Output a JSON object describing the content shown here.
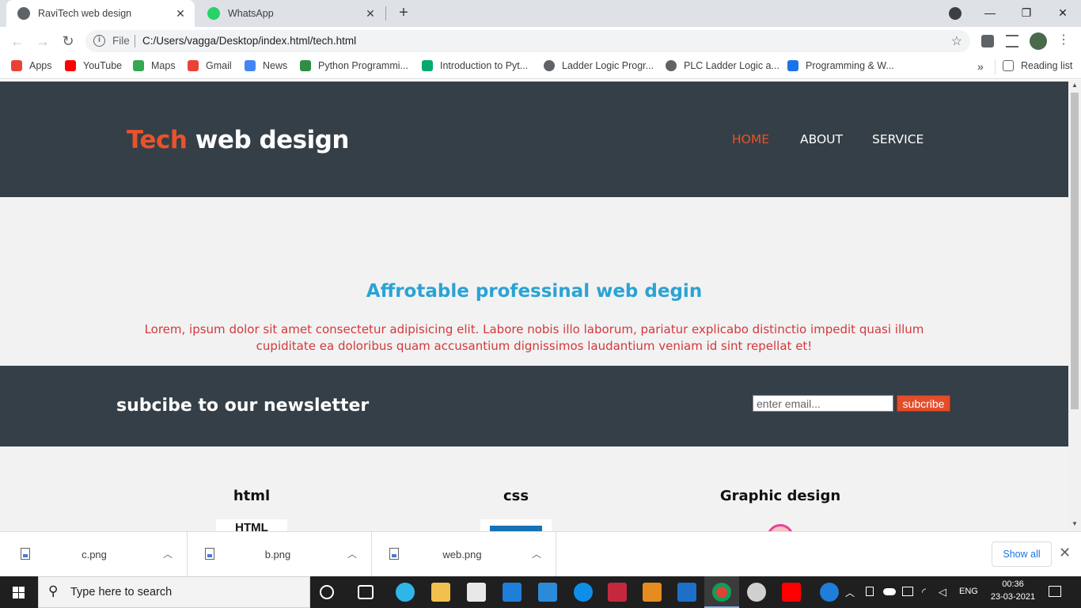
{
  "browser": {
    "tabs": [
      {
        "title": "RaviTech web design",
        "close": "✕"
      },
      {
        "title": "WhatsApp",
        "close": "✕"
      }
    ],
    "new_tab": "+",
    "window_controls": {
      "minimize": "—",
      "restore": "❐",
      "close": "✕"
    },
    "address": {
      "scheme": "File",
      "url": "C:/Users/vagga/Desktop/index.html/tech.html"
    },
    "bookmarks": [
      {
        "label": "Apps",
        "icon": "apps-grid-icon",
        "color": "#e94235"
      },
      {
        "label": "YouTube",
        "icon": "youtube-icon",
        "color": "#ff0000"
      },
      {
        "label": "Maps",
        "icon": "maps-icon",
        "color": "#34a853"
      },
      {
        "label": "Gmail",
        "icon": "gmail-icon",
        "color": "#ea4335"
      },
      {
        "label": "News",
        "icon": "news-icon",
        "color": "#4285f4"
      },
      {
        "label": "Python Programmi...",
        "icon": "gfg-icon",
        "color": "#2f8d46"
      },
      {
        "label": "Introduction to Pyt...",
        "icon": "w3-icon",
        "color": "#04aa6d"
      },
      {
        "label": "Ladder Logic Progr...",
        "icon": "globe-icon",
        "color": "#5f6368"
      },
      {
        "label": "PLC Ladder Logic a...",
        "icon": "globe-icon",
        "color": "#5f6368"
      },
      {
        "label": "Programming & W...",
        "icon": "udemy-icon",
        "color": "#1a73e8"
      }
    ],
    "more": "»",
    "reading_list": "Reading list"
  },
  "site": {
    "logo_accent": "Tech",
    "logo_rest": " web design",
    "nav": [
      "HOME",
      "ABOUT",
      "SERVICE"
    ],
    "hero_title": "Affrotable professinal web degin",
    "hero_text": "Lorem, ipsum dolor sit amet consectetur adipisicing elit. Labore nobis illo laborum, pariatur explicabo distinctio impedit quasi illum cupiditate ea doloribus quam accusantium dignissimos laudantium veniam id sint repellat et!",
    "newsletter_title": "subcibe to our newsletter",
    "email_placeholder": "enter email...",
    "subscribe_label": "subcribe",
    "services": [
      {
        "title": "html",
        "image_text": "HTML"
      },
      {
        "title": "css"
      },
      {
        "title": "Graphic design"
      }
    ],
    "colors": {
      "header": "#353f47",
      "accent": "#e8532b",
      "title": "#2aa3d4",
      "body_text": "#d4383c"
    }
  },
  "downloads": {
    "items": [
      "c.png",
      "b.png",
      "web.png"
    ],
    "show_all": "Show all",
    "close": "✕"
  },
  "taskbar": {
    "search_placeholder": "Type here to search",
    "language": "ENG",
    "time": "00:36",
    "date": "23-03-2021"
  }
}
